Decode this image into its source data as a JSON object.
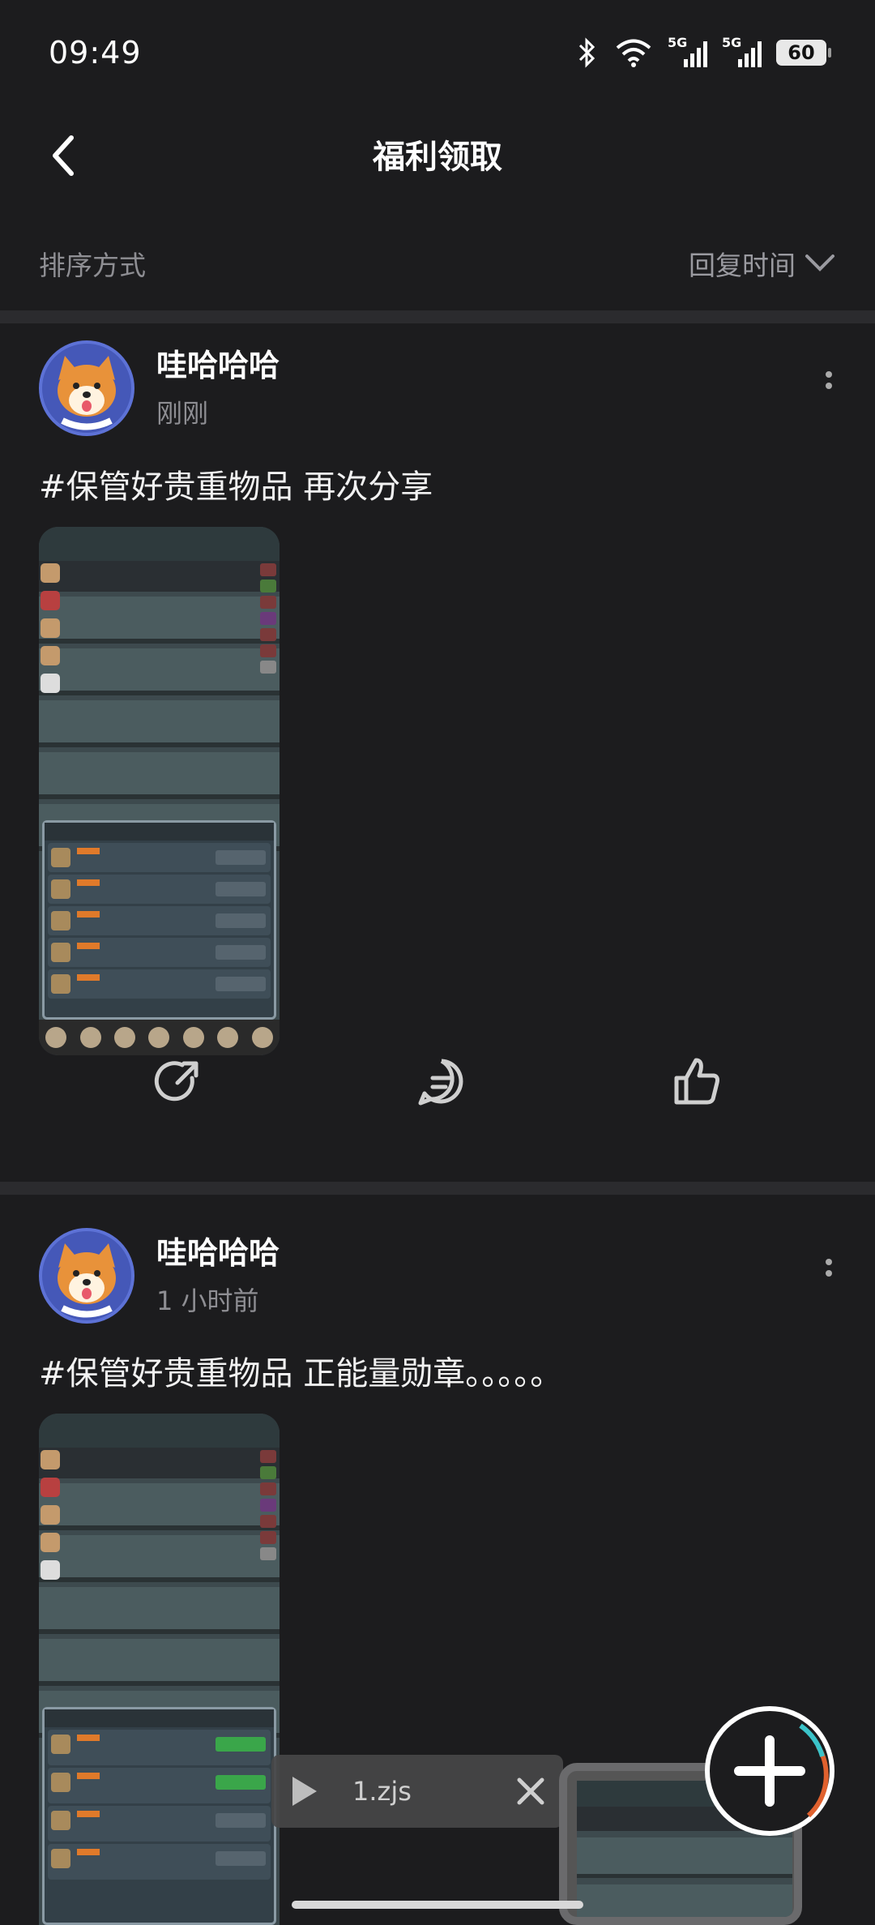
{
  "status": {
    "time": "09:49",
    "signal1": "5G",
    "signal2": "5G",
    "battery": "60"
  },
  "header": {
    "title": "福利领取"
  },
  "sort": {
    "label": "排序方式",
    "value": "回复时间"
  },
  "posts": [
    {
      "author": "哇哈哈哈",
      "time": "刚刚",
      "text": "#保管好贵重物品 再次分享"
    },
    {
      "author": "哇哈哈哈",
      "time": "1 小时前",
      "text": "#保管好贵重物品 正能量勋章。。。。。"
    }
  ],
  "player": {
    "filename": "1.zjs"
  },
  "colors": {
    "background": "#1c1c1e",
    "muted": "#8e8e93",
    "fab_accent": "#e0612e",
    "fab_ring2": "#3bc3c9"
  }
}
